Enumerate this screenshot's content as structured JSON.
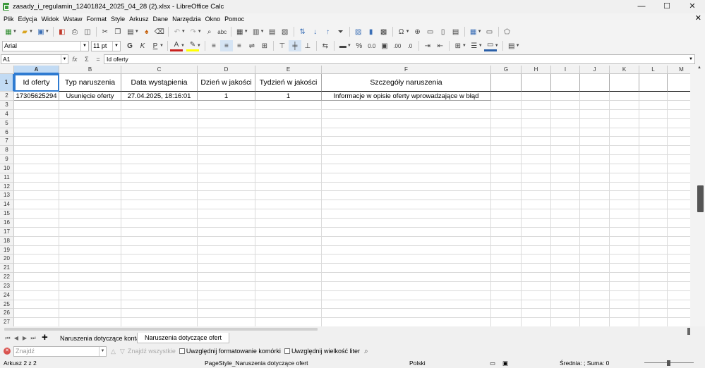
{
  "window": {
    "title": "zasady_i_regulamin_12401824_2025_04_28 (2).xlsx - LibreOffice Calc",
    "minimize": "—",
    "maximize": "☐",
    "close": "✕"
  },
  "menu": [
    "Plik",
    "Edycja",
    "Widok",
    "Wstaw",
    "Format",
    "Style",
    "Arkusz",
    "Dane",
    "Narzędzia",
    "Okno",
    "Pomoc"
  ],
  "format_toolbar": {
    "font_name": "Arial",
    "font_size": "11 pt",
    "bold": "G",
    "italic": "K",
    "underline": "P",
    "percent": "%",
    "number": "0.0"
  },
  "formula_bar": {
    "cell_ref": "A1",
    "fx": "fx",
    "sum": "Σ",
    "equals": "=",
    "content": "Id oferty"
  },
  "columns": [
    {
      "label": "A"
    },
    {
      "label": "B"
    },
    {
      "label": "C"
    },
    {
      "label": "D"
    },
    {
      "label": "E"
    },
    {
      "label": "F"
    },
    {
      "label": "G"
    },
    {
      "label": "H"
    },
    {
      "label": "I"
    },
    {
      "label": "J"
    },
    {
      "label": "K"
    },
    {
      "label": "L"
    },
    {
      "label": "M"
    }
  ],
  "rows": [
    "1",
    "2",
    "3",
    "4",
    "5",
    "6",
    "7",
    "8",
    "9",
    "10",
    "11",
    "12",
    "13",
    "14",
    "15",
    "16",
    "17",
    "18",
    "19",
    "20",
    "21",
    "22",
    "23",
    "24",
    "25",
    "26",
    "27"
  ],
  "sheet": {
    "header": [
      "Id oferty",
      "Typ naruszenia",
      "Data wystąpienia",
      "Dzień w jakości",
      "Tydzień w jakości",
      "Szczegóły naruszenia"
    ],
    "data_rows": [
      [
        "17305625294",
        "Usunięcie oferty",
        "27.04.2025, 18:16:01",
        "1",
        "1",
        "Informacje w opisie oferty wprowadzające w błąd"
      ]
    ]
  },
  "tabs": {
    "add": "+",
    "items": [
      "Naruszenia dotyczące konta",
      "Naruszenia dotyczące ofert"
    ],
    "active": "Naruszenia dotyczące ofert"
  },
  "find": {
    "placeholder": "Znajdź",
    "find_all": "Znajdź wszystkie",
    "match_format": "Uwzględnij formatowanie komórki",
    "match_case": "Uwzględnij wielkość liter"
  },
  "status": {
    "sheet": "Arkusz 2 z 2",
    "page_style": "PageStyle_Naruszenia dotyczące ofert",
    "language": "Polski",
    "stats": "Średnia: ; Suma: 0"
  }
}
